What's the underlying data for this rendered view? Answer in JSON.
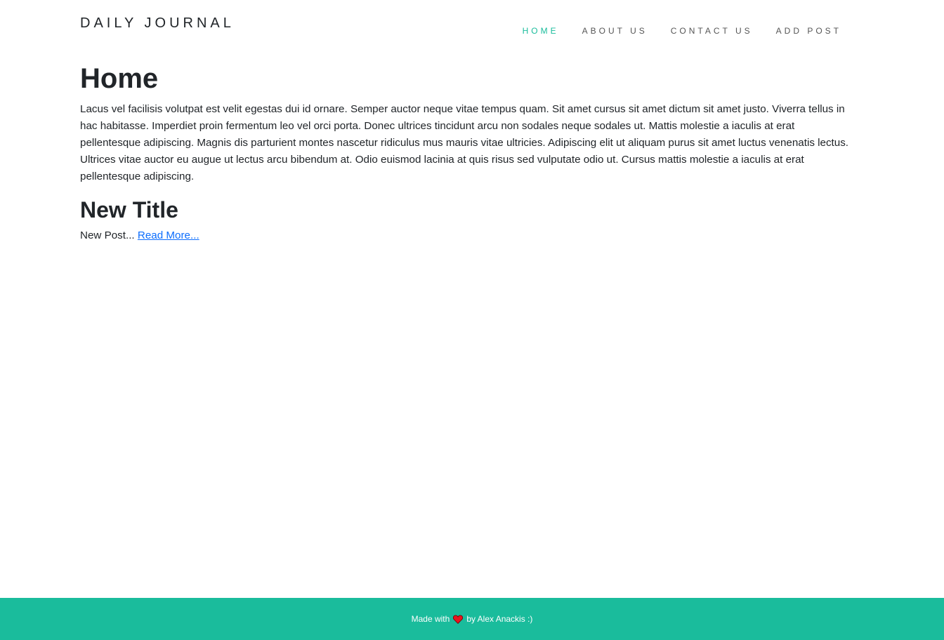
{
  "header": {
    "brand": "DAILY JOURNAL",
    "nav": [
      {
        "label": "HOME",
        "active": true
      },
      {
        "label": "ABOUT US",
        "active": false
      },
      {
        "label": "CONTACT US",
        "active": false
      },
      {
        "label": "ADD POST",
        "active": false
      }
    ]
  },
  "main": {
    "title": "Home",
    "intro": "Lacus vel facilisis volutpat est velit egestas dui id ornare. Semper auctor neque vitae tempus quam. Sit amet cursus sit amet dictum sit amet justo. Viverra tellus in hac habitasse. Imperdiet proin fermentum leo vel orci porta. Donec ultrices tincidunt arcu non sodales neque sodales ut. Mattis molestie a iaculis at erat pellentesque adipiscing. Magnis dis parturient montes nascetur ridiculus mus mauris vitae ultricies. Adipiscing elit ut aliquam purus sit amet luctus venenatis lectus. Ultrices vitae auctor eu augue ut lectus arcu bibendum at. Odio euismod lacinia at quis risus sed vulputate odio ut. Cursus mattis molestie a iaculis at erat pellentesque adipiscing.",
    "posts": [
      {
        "title": "New Title",
        "excerpt": "New Post... ",
        "read_more": "Read More..."
      }
    ]
  },
  "footer": {
    "made_with": "Made with",
    "heart_icon": "heart-icon",
    "by": "by Alex Anackis :)"
  },
  "colors": {
    "accent": "#1abc9c",
    "link": "#0d6efd",
    "heart": "#e8141e"
  }
}
